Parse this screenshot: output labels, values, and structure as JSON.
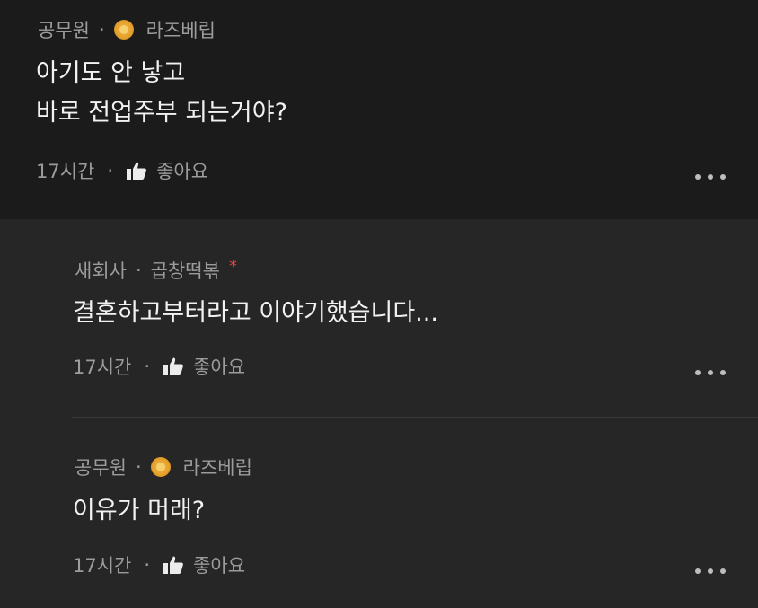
{
  "comments": [
    {
      "job": "공무원",
      "badge_icon": "gold-badge-icon",
      "nickname": "라즈베립",
      "lines": [
        "아기도 안 낳고",
        "바로 전업주부 되는거야?"
      ],
      "time": "17시간",
      "like_label": "좋아요"
    },
    {
      "job": "새회사",
      "nickname": "곱창떡볶",
      "author_marker": "*",
      "lines": [
        "결혼하고부터라고 이야기했습니다..."
      ],
      "time": "17시간",
      "like_label": "좋아요"
    },
    {
      "job": "공무원",
      "badge_icon": "gold-badge-icon",
      "nickname": "라즈베립",
      "lines": [
        "이유가 머래?"
      ],
      "time": "17시간",
      "like_label": "좋아요"
    }
  ],
  "separator": "·",
  "colors": {
    "background": "#1b1b1c",
    "reply_background": "#262627",
    "text": "#f2f2f2",
    "meta": "#9c9c9c",
    "accent_red": "#e0443a",
    "badge_gold": "#e6a22c"
  }
}
